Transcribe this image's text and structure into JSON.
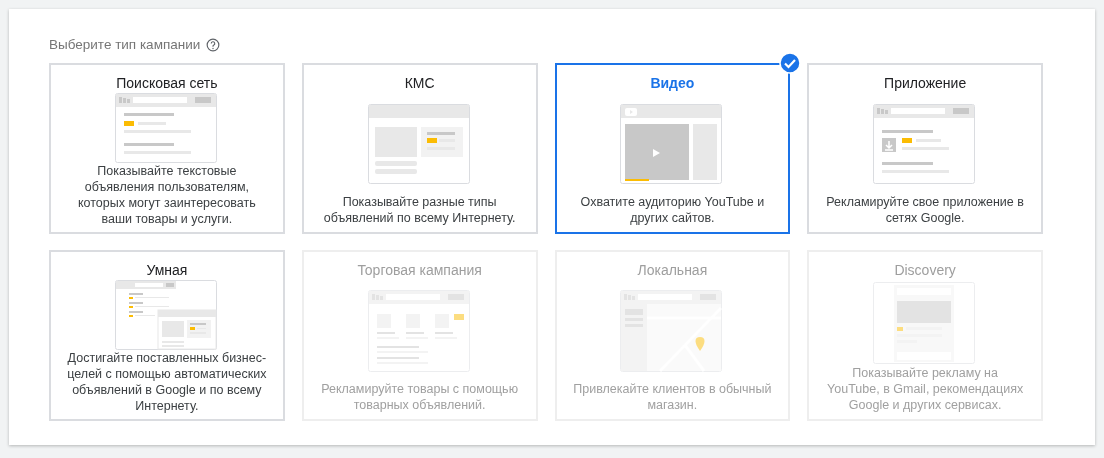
{
  "heading": "Выберите тип кампании",
  "cards": [
    {
      "kind": "search",
      "title": "Поисковая сеть",
      "description": "Показывайте текстовые объявления пользователям, которых могут заинтересовать ваши товары и услуги.",
      "selected": false,
      "disabled": false
    },
    {
      "kind": "display",
      "title": "КМС",
      "description": "Показывайте разные типы объявлений по всему Интернету.",
      "selected": false,
      "disabled": false
    },
    {
      "kind": "video",
      "title": "Видео",
      "description": "Охватите аудиторию YouTube и других сайтов.",
      "selected": true,
      "disabled": false
    },
    {
      "kind": "app",
      "title": "Приложение",
      "description": "Рекламируйте свое приложение в сетях Google.",
      "selected": false,
      "disabled": false
    },
    {
      "kind": "smart",
      "title": "Умная",
      "description": "Достигайте поставленных бизнес-целей с помощью автоматических объявлений в Google и по всему Интернету.",
      "selected": false,
      "disabled": false
    },
    {
      "kind": "shopping",
      "title": "Торговая кампания",
      "description": "Рекламируйте товары с помощью товарных объявлений.",
      "selected": false,
      "disabled": true
    },
    {
      "kind": "local",
      "title": "Локальная",
      "description": "Привлекайте клиентов в обычный магазин.",
      "selected": false,
      "disabled": true
    },
    {
      "kind": "discovery",
      "title": "Discovery",
      "description": "Показывайте рекламу на YouTube, в Gmail, рекомендациях Google и других сервисах.",
      "selected": false,
      "disabled": true
    }
  ]
}
